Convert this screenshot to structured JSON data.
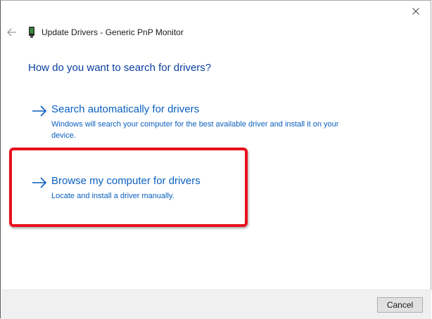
{
  "window": {
    "title": "Update Drivers - Generic PnP Monitor"
  },
  "main": {
    "heading": "How do you want to search for drivers?",
    "options": [
      {
        "title": "Search automatically for drivers",
        "description": "Windows will search your computer for the best available driver and install it on your device."
      },
      {
        "title": "Browse my computer for drivers",
        "description": "Locate and install a driver manually."
      }
    ]
  },
  "footer": {
    "cancel_label": "Cancel"
  },
  "icons": {
    "back": "back-arrow-icon",
    "close": "close-icon",
    "title": "monitor-device-icon",
    "option_arrow": "right-arrow-icon"
  },
  "colors": {
    "heading": "#0a3fa0",
    "link": "#0a5fbf",
    "highlight": "#e8101c",
    "footer_bg": "#f0f0f0"
  }
}
